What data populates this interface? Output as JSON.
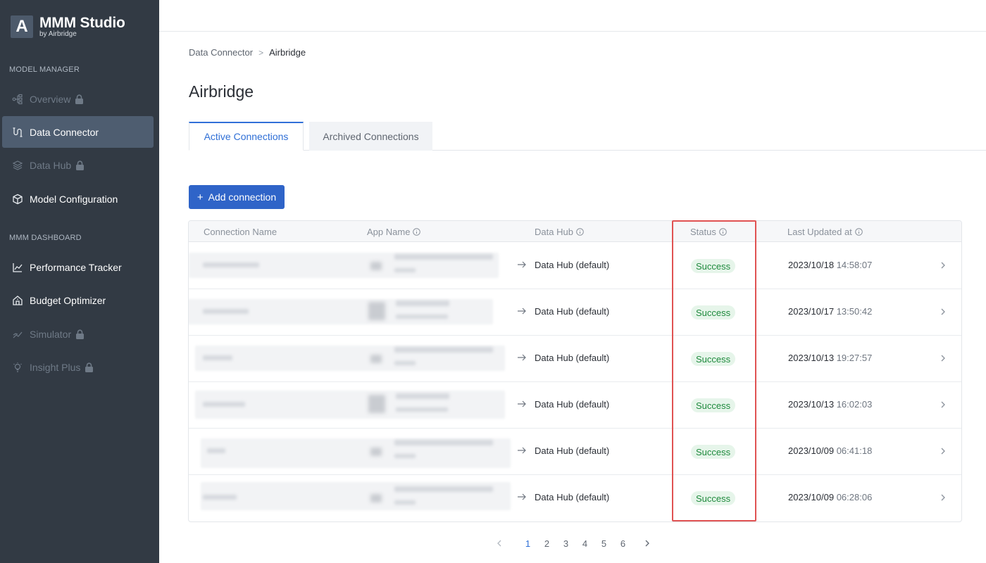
{
  "app": {
    "logo_mark": "A",
    "title": "MMM Studio",
    "subtitle": "by Airbridge"
  },
  "sidebar": {
    "sections": [
      {
        "label": "MODEL MANAGER"
      },
      {
        "label": "MMM DASHBOARD"
      }
    ],
    "items": [
      {
        "label": "Overview",
        "icon": "nodes-icon",
        "locked": true
      },
      {
        "label": "Data Connector",
        "icon": "connector-icon",
        "active": true
      },
      {
        "label": "Data Hub",
        "icon": "layers-icon",
        "locked": true
      },
      {
        "label": "Model Configuration",
        "icon": "cube-icon"
      },
      {
        "label": "Performance Tracker",
        "icon": "chart-line-icon"
      },
      {
        "label": "Budget Optimizer",
        "icon": "house-icon"
      },
      {
        "label": "Simulator",
        "icon": "trend-icon",
        "locked": true
      },
      {
        "label": "Insight Plus",
        "icon": "bulb-icon",
        "locked": true
      }
    ]
  },
  "breadcrumb": {
    "parent": "Data Connector",
    "separator": ">",
    "current": "Airbridge"
  },
  "page": {
    "title": "Airbridge"
  },
  "tabs": [
    {
      "label": "Active Connections",
      "active": true
    },
    {
      "label": "Archived Connections",
      "active": false
    }
  ],
  "actions": {
    "add_label": "Add connection",
    "add_icon": "+"
  },
  "table": {
    "columns": [
      "Connection Name",
      "App Name",
      "Data Hub",
      "Status",
      "Last Updated at"
    ],
    "rows": [
      {
        "hub": "Data Hub (default)",
        "status": "Success",
        "date": "2023/10/18",
        "time": "14:58:07"
      },
      {
        "hub": "Data Hub (default)",
        "status": "Success",
        "date": "2023/10/17",
        "time": "13:50:42"
      },
      {
        "hub": "Data Hub (default)",
        "status": "Success",
        "date": "2023/10/13",
        "time": "19:27:57"
      },
      {
        "hub": "Data Hub (default)",
        "status": "Success",
        "date": "2023/10/13",
        "time": "16:02:03"
      },
      {
        "hub": "Data Hub (default)",
        "status": "Success",
        "date": "2023/10/09",
        "time": "06:41:18"
      },
      {
        "hub": "Data Hub (default)",
        "status": "Success",
        "date": "2023/10/09",
        "time": "06:28:06"
      }
    ]
  },
  "pagination": {
    "pages": [
      "1",
      "2",
      "3",
      "4",
      "5",
      "6"
    ],
    "current": "1"
  },
  "colors": {
    "sidebar_bg": "#323a44",
    "primary": "#2f64c8",
    "success_bg": "#e6f5ea",
    "success_text": "#1f8a3d",
    "highlight": "#e05252"
  }
}
